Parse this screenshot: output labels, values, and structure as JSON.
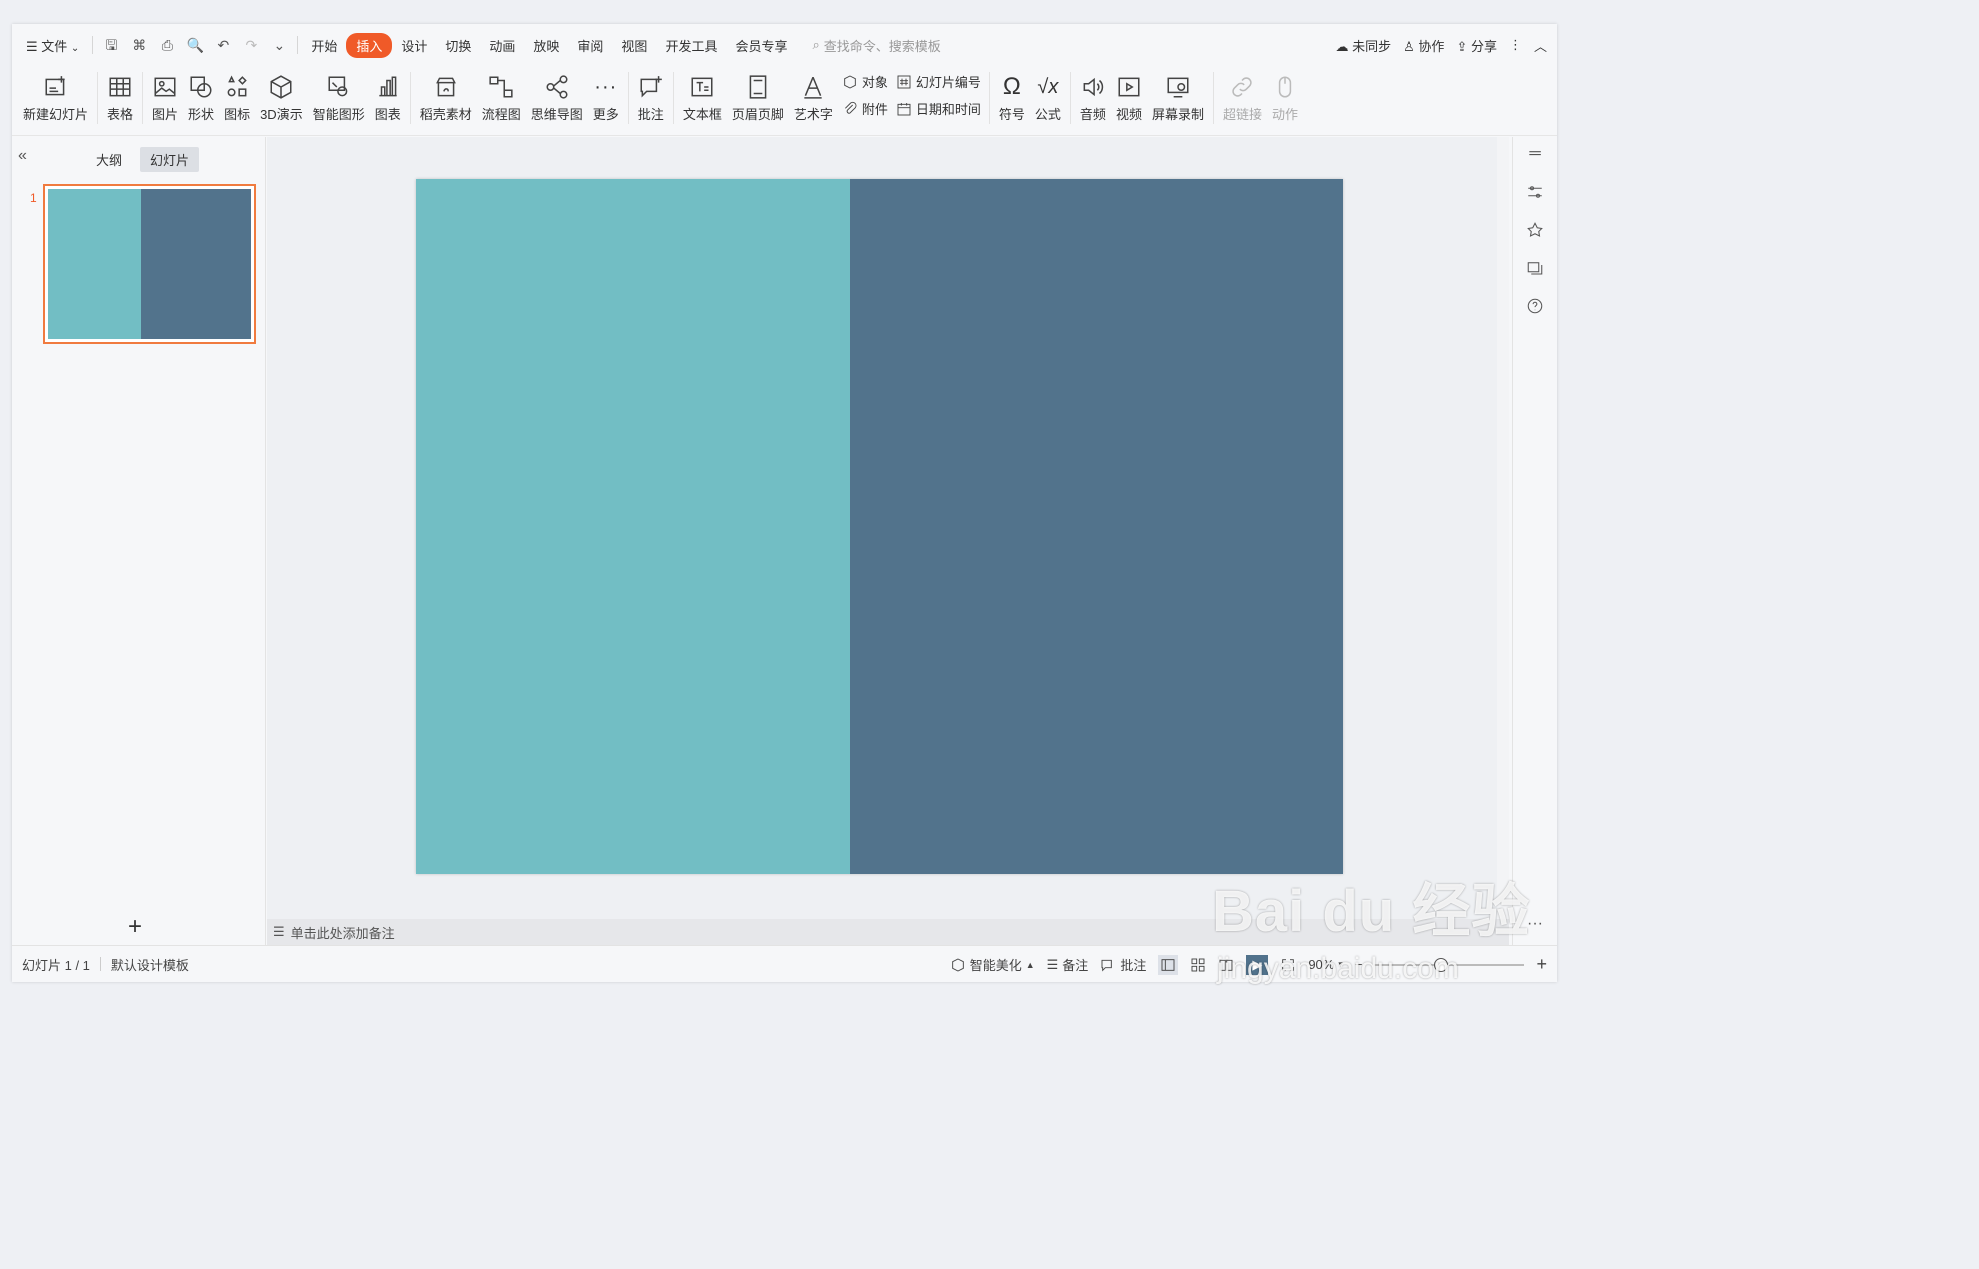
{
  "topbar": {
    "menu_label": "文件",
    "tabs": [
      "开始",
      "插入",
      "设计",
      "切换",
      "动画",
      "放映",
      "审阅",
      "视图",
      "开发工具",
      "会员专享"
    ],
    "active_tab": "插入",
    "search_placeholder": "查找命令、搜索模板",
    "sync": "未同步",
    "collab": "协作",
    "share": "分享"
  },
  "ribbon": {
    "new_slide": "新建幻灯片",
    "table": "表格",
    "picture": "图片",
    "shape": "形状",
    "icon": "图标",
    "demo3d": "3D演示",
    "smartart": "智能图形",
    "chart": "图表",
    "material": "稻壳素材",
    "flowchart": "流程图",
    "mindmap": "思维导图",
    "more": "更多",
    "comment": "批注",
    "textbox": "文本框",
    "header_footer": "页眉页脚",
    "wordart": "艺术字",
    "object": "对象",
    "slide_number": "幻灯片编号",
    "attachment": "附件",
    "datetime": "日期和时间",
    "symbol": "符号",
    "formula": "公式",
    "audio": "音频",
    "video": "视频",
    "screen_record": "屏幕录制",
    "hyperlink": "超链接",
    "action": "动作"
  },
  "leftpanel": {
    "tab_outline": "大纲",
    "tab_slides": "幻灯片",
    "slide_number": "1"
  },
  "slide": {
    "left_color": "#72bec4",
    "right_color": "#52738c"
  },
  "notes": {
    "placeholder": "单击此处添加备注"
  },
  "status": {
    "slide_info": "幻灯片 1 / 1",
    "template": "默认设计模板",
    "beautify": "智能美化",
    "notes": "备注",
    "comments": "批注",
    "zoom": "90%"
  },
  "watermark": {
    "brand": "Bai du 经验",
    "url": "jingyan.baidu.com"
  }
}
